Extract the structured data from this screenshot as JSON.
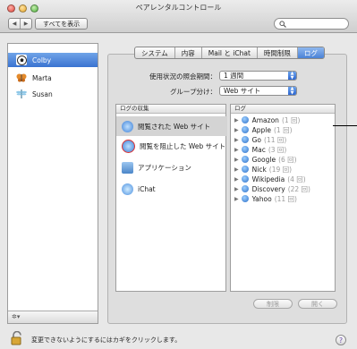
{
  "window": {
    "title": "ペアレンタルコントロール"
  },
  "toolbar": {
    "back_glyph": "◀",
    "forward_glyph": "▶",
    "show_all_label": "すべてを表示",
    "search_placeholder": ""
  },
  "sidebar": {
    "users": [
      {
        "name": "Colby",
        "selected": true,
        "icon": "soccer-ball-avatar"
      },
      {
        "name": "Marta",
        "selected": false,
        "icon": "butterfly-avatar"
      },
      {
        "name": "Susan",
        "selected": false,
        "icon": "dragonfly-avatar"
      }
    ],
    "gear_menu_label": "✲▾"
  },
  "tabs": [
    {
      "label": "システム",
      "active": false
    },
    {
      "label": "内容",
      "active": false
    },
    {
      "label": "Mail と iChat",
      "active": false
    },
    {
      "label": "時間制限",
      "active": false
    },
    {
      "label": "ログ",
      "active": true
    }
  ],
  "filters": {
    "period_label": "使用状況の照会期間：",
    "period_value": "1 週間",
    "group_label": "グループ分け：",
    "group_value": "Web サイト"
  },
  "log_collection": {
    "header": "ログの収集",
    "items": [
      {
        "label": "閲覧された Web サイト",
        "selected": true
      },
      {
        "label": "閲覧を阻止した Web サイト",
        "selected": false
      },
      {
        "label": "アプリケーション",
        "selected": false
      },
      {
        "label": "iChat",
        "selected": false
      }
    ]
  },
  "logs": {
    "header": "ログ",
    "rows": [
      {
        "site": "Amazon",
        "count": "(1 回)"
      },
      {
        "site": "Apple",
        "count": "(1 回)"
      },
      {
        "site": "Go",
        "count": "(11 回)"
      },
      {
        "site": "Mac",
        "count": "(3 回)"
      },
      {
        "site": "Google",
        "count": "(6 回)"
      },
      {
        "site": "Nick",
        "count": "(19 回)"
      },
      {
        "site": "Wikipedia",
        "count": "(4 回)"
      },
      {
        "site": "Discovery",
        "count": "(22 回)"
      },
      {
        "site": "Yahoo",
        "count": "(11 回)"
      }
    ]
  },
  "actions": {
    "restrict_label": "制限",
    "open_label": "開く"
  },
  "footer": {
    "lock_text": "変更できないようにするにはカギをクリックします。",
    "help_label": "?"
  },
  "colors": {
    "selection_blue": "#3a73d1",
    "tab_active": "#4a82d6",
    "log_count_gray": "#9a9a9a"
  }
}
